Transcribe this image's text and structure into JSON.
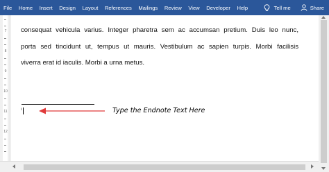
{
  "ribbon": {
    "tabs": [
      "File",
      "Home",
      "Insert",
      "Design",
      "Layout",
      "References",
      "Mailings",
      "Review",
      "View",
      "Developer",
      "Help"
    ],
    "tell_me": "Tell me",
    "share": "Share",
    "tell_me_icon": "lightbulb-icon",
    "share_icon": "person-icon",
    "color": "#2b579a"
  },
  "document": {
    "lines": [
      "consequat vehicula varius. Integer pharetra sem ac accumsan pretium. Duis leo nunc,",
      "porta sed tincidunt ut, tempus ut mauris. Vestibulum ac sapien turpis. Morbi facilisis",
      "viverra erat id iaculis. Morbi a urna metus."
    ],
    "endnote_mark": "i",
    "annotation": "Type the Endnote Text Here",
    "arrow_color": "#e03a3a"
  },
  "ruler": {
    "numbers": [
      "7",
      "8",
      "9",
      "10",
      "11",
      "12"
    ]
  }
}
